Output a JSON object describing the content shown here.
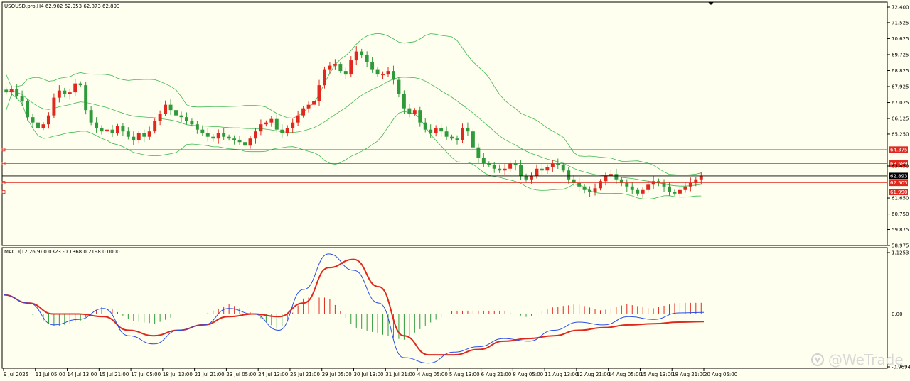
{
  "colors": {
    "background": "#fffff0",
    "frame": "#000000",
    "bull": "#e0281e",
    "bear": "#2e9a3a",
    "bands": "#3fb950",
    "level_line": "#e0281e",
    "price_line": "#000000",
    "macd_signal": "#e0281e",
    "macd_line": "#2a4ee8",
    "hist_pos": "#e0281e",
    "hist_neg": "#2e9a3a"
  },
  "header": {
    "symbol_info": "USOUSD.pro,H4  62.902 62.953 62.873 62.893"
  },
  "price_axis": {
    "ticks": [
      "72.400",
      "71.525",
      "70.625",
      "69.725",
      "68.825",
      "67.925",
      "67.025",
      "66.125",
      "65.250",
      "63.450",
      "61.650",
      "60.750",
      "59.875",
      "58.975"
    ],
    "tick_values": [
      72.4,
      71.525,
      70.625,
      69.725,
      68.825,
      67.925,
      67.025,
      66.125,
      65.25,
      63.45,
      61.65,
      60.75,
      59.875,
      58.975
    ],
    "range": [
      58.975,
      72.4
    ]
  },
  "levels": [
    {
      "value": 64.375,
      "label": "64.375",
      "kind": "level"
    },
    {
      "value": 63.589,
      "label": "63.589",
      "kind": "level"
    },
    {
      "value": 62.893,
      "label": "62.893",
      "kind": "current"
    },
    {
      "value": 62.505,
      "label": "62.505",
      "kind": "level"
    },
    {
      "value": 61.99,
      "label": "61.990",
      "kind": "level"
    }
  ],
  "time_axis": {
    "labels": [
      "9 Jul 2025",
      "11 Jul 05:00",
      "14 Jul 13:00",
      "15 Jul 21:00",
      "17 Jul 05:00",
      "18 Jul 13:00",
      "21 Jul 21:00",
      "23 Jul 05:00",
      "24 Jul 13:00",
      "25 Jul 21:00",
      "29 Jul 05:00",
      "30 Jul 13:00",
      "31 Jul 21:00",
      "4 Aug 05:00",
      "5 Aug 13:00",
      "6 Aug 21:00",
      "8 Aug 05:00",
      "11 Aug 13:00",
      "12 Aug 21:00",
      "14 Aug 05:00",
      "15 Aug 13:00",
      "18 Aug 21:00",
      "20 Aug 05:00"
    ]
  },
  "macd": {
    "info": "MACD(12,26,9) 0.0323 -0.1368 0.2198 0.0000",
    "ticks": [
      "1.1253",
      "0.00",
      "-0.9694"
    ],
    "tick_values": [
      1.1253,
      0.0,
      -0.9694
    ],
    "range": [
      -0.9694,
      1.1253
    ]
  },
  "watermark": {
    "text": "@WeTrade"
  },
  "chart_data": {
    "type": "candlestick",
    "symbol": "USOUSD.pro",
    "timeframe": "H4",
    "ohlc_current": {
      "open": 62.902,
      "high": 62.953,
      "low": 62.873,
      "close": 62.893
    },
    "candles_close": [
      67.6,
      67.8,
      67.4,
      67.1,
      66.2,
      65.9,
      65.6,
      65.8,
      66.3,
      67.3,
      67.7,
      67.5,
      67.6,
      68.1,
      68.0,
      66.6,
      65.9,
      65.6,
      65.4,
      65.5,
      65.3,
      65.7,
      65.4,
      65.1,
      64.9,
      65.3,
      65.1,
      65.4,
      66.0,
      66.4,
      66.9,
      66.6,
      66.3,
      66.2,
      66.0,
      65.8,
      65.5,
      65.3,
      65.1,
      65.0,
      65.3,
      65.1,
      65.0,
      64.9,
      64.8,
      64.6,
      65.0,
      65.4,
      65.8,
      65.9,
      66.1,
      65.5,
      65.3,
      65.6,
      65.9,
      66.3,
      66.7,
      66.9,
      67.1,
      68.0,
      68.9,
      69.1,
      69.2,
      68.8,
      68.6,
      69.4,
      69.9,
      69.7,
      69.3,
      68.9,
      68.6,
      68.6,
      68.8,
      68.3,
      67.5,
      66.7,
      66.4,
      66.6,
      65.9,
      65.5,
      65.3,
      65.6,
      65.4,
      65.1,
      65.0,
      64.9,
      65.6,
      65.4,
      64.5,
      63.9,
      63.6,
      63.5,
      63.3,
      63.2,
      63.3,
      63.6,
      63.5,
      62.9,
      62.7,
      62.9,
      63.3,
      63.2,
      63.4,
      63.6,
      63.5,
      63.2,
      62.7,
      62.5,
      62.3,
      62.1,
      62.0,
      62.2,
      62.6,
      62.9,
      63.0,
      62.7,
      62.5,
      62.3,
      62.1,
      61.9,
      62.1,
      62.4,
      62.6,
      62.5,
      62.3,
      62.0,
      61.9,
      62.1,
      62.3,
      62.5,
      62.7,
      62.9
    ],
    "macd_main": [
      0.35,
      0.2,
      -0.2,
      -0.1,
      0.1,
      -0.4,
      -0.55,
      -0.3,
      -0.2,
      0.1,
      0.0,
      -0.3,
      0.45,
      1.1,
      0.8,
      0.2,
      -0.8,
      -0.9,
      -0.7,
      -0.6,
      -0.45,
      -0.5,
      -0.3,
      -0.15,
      -0.2,
      -0.05,
      -0.1,
      0.02,
      0.03
    ],
    "macd_signal": [
      0.35,
      0.2,
      0.0,
      0.0,
      -0.05,
      -0.3,
      -0.4,
      -0.3,
      -0.2,
      -0.05,
      0.0,
      -0.05,
      0.2,
      0.85,
      1.0,
      0.5,
      -0.4,
      -0.75,
      -0.75,
      -0.65,
      -0.5,
      -0.45,
      -0.4,
      -0.3,
      -0.25,
      -0.2,
      -0.18,
      -0.15,
      -0.14
    ]
  }
}
